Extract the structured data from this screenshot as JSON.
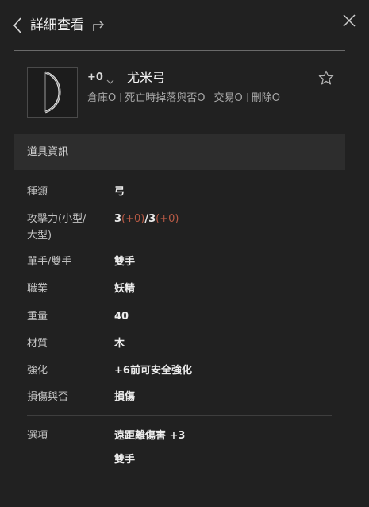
{
  "header": {
    "title": "詳細查看",
    "back_icon": "chevron-left-icon",
    "share_icon": "share-icon",
    "close_icon": "close-icon"
  },
  "item": {
    "enhance_label": "+0",
    "name": "尤米弓",
    "thumbnail_icon": "bow-icon",
    "favorite_icon": "star-outline-icon",
    "props": [
      "倉庫O",
      "死亡時掉落與否O",
      "交易O",
      "刪除O"
    ]
  },
  "section": {
    "title": "道具資訊"
  },
  "attributes": {
    "type": {
      "label": "種類",
      "value": "弓"
    },
    "attack": {
      "label_line1": "攻擊力(小型/",
      "label_line2": "大型)",
      "small": "3",
      "small_bonus": "(+0)",
      "slash": "/",
      "large": "3",
      "large_bonus": "(+0)"
    },
    "hand": {
      "label": "單手/雙手",
      "value": "雙手"
    },
    "class": {
      "label": "職業",
      "value": "妖精"
    },
    "weight": {
      "label": "重量",
      "value": "40"
    },
    "material": {
      "label": "材質",
      "value": "木"
    },
    "enhance": {
      "label": "強化",
      "value": "+6前可安全強化"
    },
    "damage": {
      "label": "損傷與否",
      "value": "損傷"
    },
    "options": {
      "label": "選項",
      "values": [
        "遠距離傷害 +3",
        "雙手"
      ]
    }
  },
  "colors": {
    "background": "#212121",
    "section_bg": "#2d2d2d",
    "bonus": "#b85a45"
  }
}
